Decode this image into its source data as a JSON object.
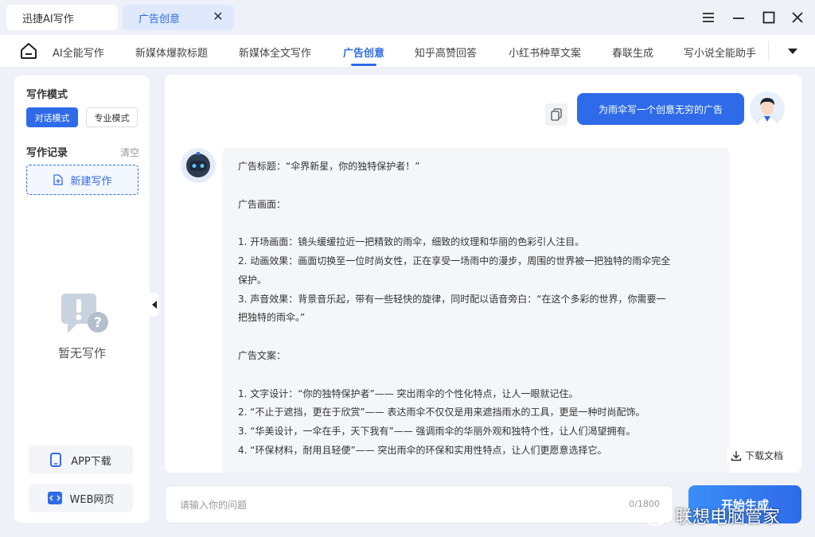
{
  "titlebar": {
    "tabs": [
      {
        "label": "迅捷AI写作"
      },
      {
        "label": "广告创意",
        "close": "✕"
      }
    ]
  },
  "nav": {
    "items": [
      "AI全能写作",
      "新媒体爆款标题",
      "新媒体全文写作",
      "广告创意",
      "知乎高赞回答",
      "小红书种草文案",
      "春联生成",
      "写小说全能助手"
    ],
    "active_index": 3
  },
  "sidebar": {
    "mode_title": "写作模式",
    "mode_chat": "对话模式",
    "mode_pro": "专业模式",
    "record_title": "写作记录",
    "clear": "清空",
    "new_label": "新建写作",
    "empty_text": "暂无写作",
    "app_download": "APP下载",
    "web_page": "WEB网页"
  },
  "chat": {
    "user_message": "为雨伞写一个创意无穷的广告",
    "bot_lines": [
      "广告标题：“伞界新星，你的独特保护者！”",
      "",
      "广告画面：",
      "",
      "1. 开场画面：镜头缓缓拉近一把精致的雨伞，细致的纹理和华丽的色彩引人注目。",
      "2. 动画效果：画面切换至一位时尚女性，正在享受一场雨中的漫步，周围的世界被一把独特的雨伞完全",
      "保护。",
      "3. 声音效果：背景音乐起，带有一些轻快的旋律，同时配以语音旁白：“在这个多彩的世界，你需要一",
      "把独特的雨伞。”",
      "",
      "广告文案：",
      "",
      "1. 文字设计：“你的独特保护者”—— 突出雨伞的个性化特点，让人一眼就记住。",
      "2. “不止于遮挡，更在于欣赏”—— 表达雨伞不仅仅是用来遮挡雨水的工具，更是一种时尚配饰。",
      "3. “华美设计，一伞在手，天下我有”—— 强调雨伞的华丽外观和独特个性，让人们渴望拥有。",
      "4. “环保材料，耐用且轻便”—— 突出雨伞的环保和实用性特点，让人们更愿意选择它。"
    ],
    "download_label": "下载文档"
  },
  "input": {
    "placeholder": "请输入你的问题",
    "counter": "0/1800"
  },
  "generate_label": "开始生成",
  "watermark": "联想电脑管家",
  "colors": {
    "accent": "#2f6be8",
    "background": "#eef1f7"
  }
}
